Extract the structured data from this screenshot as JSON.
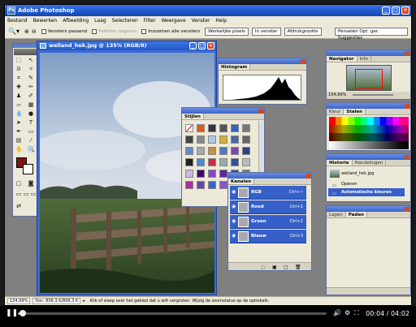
{
  "app": {
    "title": "Adobe Photoshop"
  },
  "menu": [
    "Bestand",
    "Bewerken",
    "Afbeelding",
    "Laag",
    "Selecteren",
    "Filter",
    "Weergave",
    "Venster",
    "Help"
  ],
  "options": {
    "zoom_icon": "zoom-icon",
    "chk1": "Vensters passend",
    "chk2": "Paletten negeren",
    "chk3": "Inzoomen alle vensters",
    "btn1": "Werkelijke pixels",
    "btn2": "In venster",
    "btn3": "Afdrukgrootte",
    "palette_well": "Penselen   Opt. ger.   Suggesties"
  },
  "document": {
    "title": "welland_hek.jpg @ 135% (RGB/8)"
  },
  "histogram": {
    "title": "Histogram"
  },
  "styles": {
    "title": "Stijlen"
  },
  "channels": {
    "title": "Kanalen",
    "rows": [
      {
        "name": "RGB",
        "shortcut": "Ctrl+~"
      },
      {
        "name": "Rood",
        "shortcut": "Ctrl+1"
      },
      {
        "name": "Groen",
        "shortcut": "Ctrl+2"
      },
      {
        "name": "Blauw",
        "shortcut": "Ctrl+3"
      }
    ]
  },
  "navigator": {
    "tab1": "Navigator",
    "tab2": "Info",
    "zoom": "134,99%"
  },
  "colors": {
    "tab1": "Kleur",
    "tab2": "Stalen"
  },
  "history": {
    "tab1": "Historie",
    "tab2": "Handelingen",
    "snapshot": "welland_hek.jpg",
    "item1": "Openen",
    "item2": "Automatische kleuren"
  },
  "layers": {
    "tab1": "Lagen",
    "tab2": "Paden"
  },
  "status": {
    "zoom": "134,99%",
    "doc": "Doc: 806,3 K/806,3 K",
    "hint": "Klik of sleep over het gebied dat u wilt vergroten. Wijzig de zoomstatus op de optiebalk."
  },
  "player": {
    "time": "00:04 / 04:02",
    "progress_fraction": 0.017
  }
}
